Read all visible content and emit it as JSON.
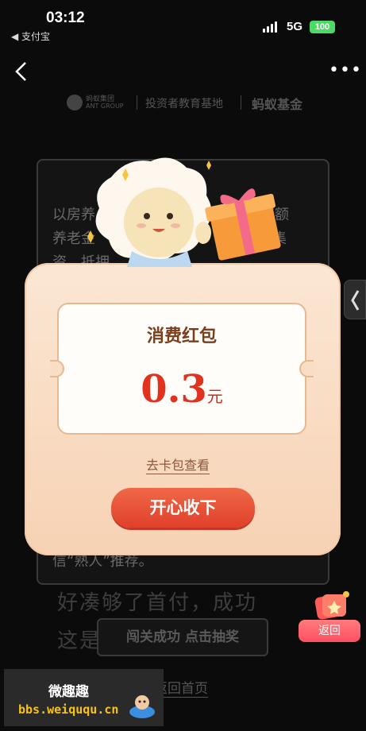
{
  "status_bar": {
    "time": "03:12",
    "back_app": "◀ 支付宝",
    "network": "5G",
    "battery": "100"
  },
  "nav": {
    "more": "•••"
  },
  "header": {
    "ant_group_cn": "蚂蚁集团",
    "ant_group_en": "ANT GROUP",
    "investor_base": "投资者教育基地",
    "ant_fund": "蚂蚁基金"
  },
  "article": {
    "line1": "以房养",
    "line1_end": "得高额",
    "line2": "养老金",
    "line2_end": "法集",
    "line3": "资，抵押",
    "line4": "信“熟人”推荐。",
    "bg_line1": "好凑够了首付，成功",
    "bg_line2": "这是",
    "bg_button": "闯关成功 点击抽奖",
    "home_link": "返回首页"
  },
  "dialog": {
    "coupon_title": "消费红包",
    "amount": "0.3",
    "unit": "元",
    "check_link": "去卡包查看",
    "accept_button": "开心收下"
  },
  "return_widget": {
    "label": "返回"
  },
  "watermark": {
    "title": "微趣趣",
    "url": "bbs.weiququ.cn"
  },
  "colors": {
    "dialog_bg": "#fbe7d4",
    "accent_red": "#e0321e",
    "button_red": "#e0402a"
  }
}
